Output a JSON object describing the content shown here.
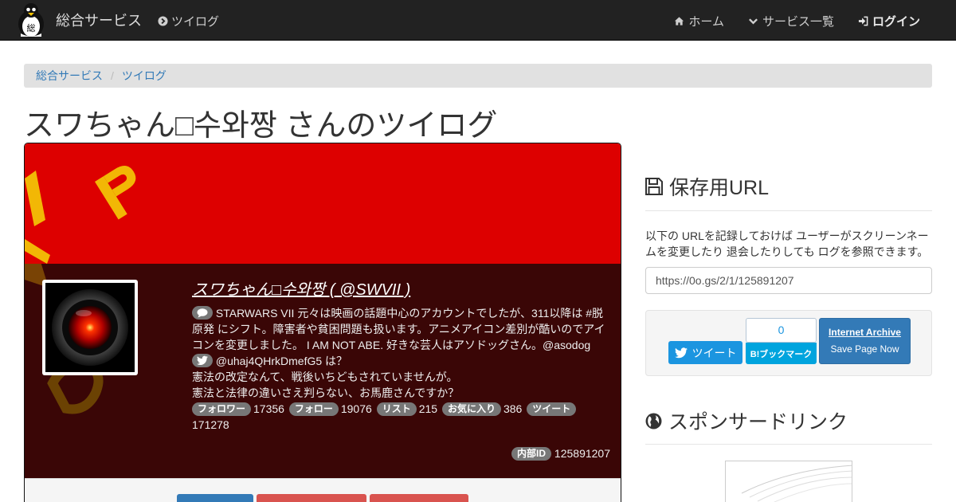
{
  "navbar": {
    "brand": "総合サービス",
    "logo_char": "総",
    "app_link": "ツイログ",
    "items": [
      {
        "label": "ホーム",
        "icon": "home-icon"
      },
      {
        "label": "サービス一覧",
        "icon": "chevron-down-icon"
      },
      {
        "label": "ログイン",
        "icon": "sign-in-icon"
      }
    ]
  },
  "breadcrumb": [
    "総合サービス",
    "ツイログ"
  ],
  "page": {
    "title": "スワちゃん□수와짱 さんのツイログ"
  },
  "profile": {
    "display_name": "スワちゃん□수와짱 ( @SWVII )",
    "bio": "STARWARS VII 元々は映画の話題中心のアカウントでしたが、311以降は #脱原発 にシフト。障害者や貧困問題も扱います。アニメアイコン差別が酷いのでアイコンを変更しました。 I AM NOT ABE. 好きな芸人はアソドッグさん。@asodog",
    "twitter_line": "@uhaj4QHrkDmefG5 は？",
    "line_1": "憲法の改定なんて、戦後いちどもされていませんが。",
    "line_2": "憲法と法律の違いさえ判らない、お馬鹿さんですか？",
    "stats": {
      "followers_label": "フォロワー",
      "followers": "17356",
      "following_label": "フォロー",
      "following": "19076",
      "lists_label": "リスト",
      "lists": "215",
      "favorites_label": "お気に入り",
      "favorites": "386",
      "tweets_label": "ツイート",
      "tweets": "171278"
    },
    "internal_id_label": "内部ID",
    "internal_id": "125891207",
    "colors": {
      "banner": "#dd0000",
      "body": "#3a0606"
    }
  },
  "sidebar": {
    "save_heading": "保存用URL",
    "save_desc": "以下の URLを記録しておけば ユーザーがスクリーンネームを変更したり 退会したりしても ログを参照できます。",
    "save_url": "https://0o.gs/2/1/125891207",
    "tweet_button": "ツイート",
    "hatena_count": "0",
    "hatena_button": "B!ブックマーク",
    "ia_title": "Internet Archive",
    "ia_sub": "Save Page Now",
    "sponsor_heading": "スポンサードリンク"
  }
}
